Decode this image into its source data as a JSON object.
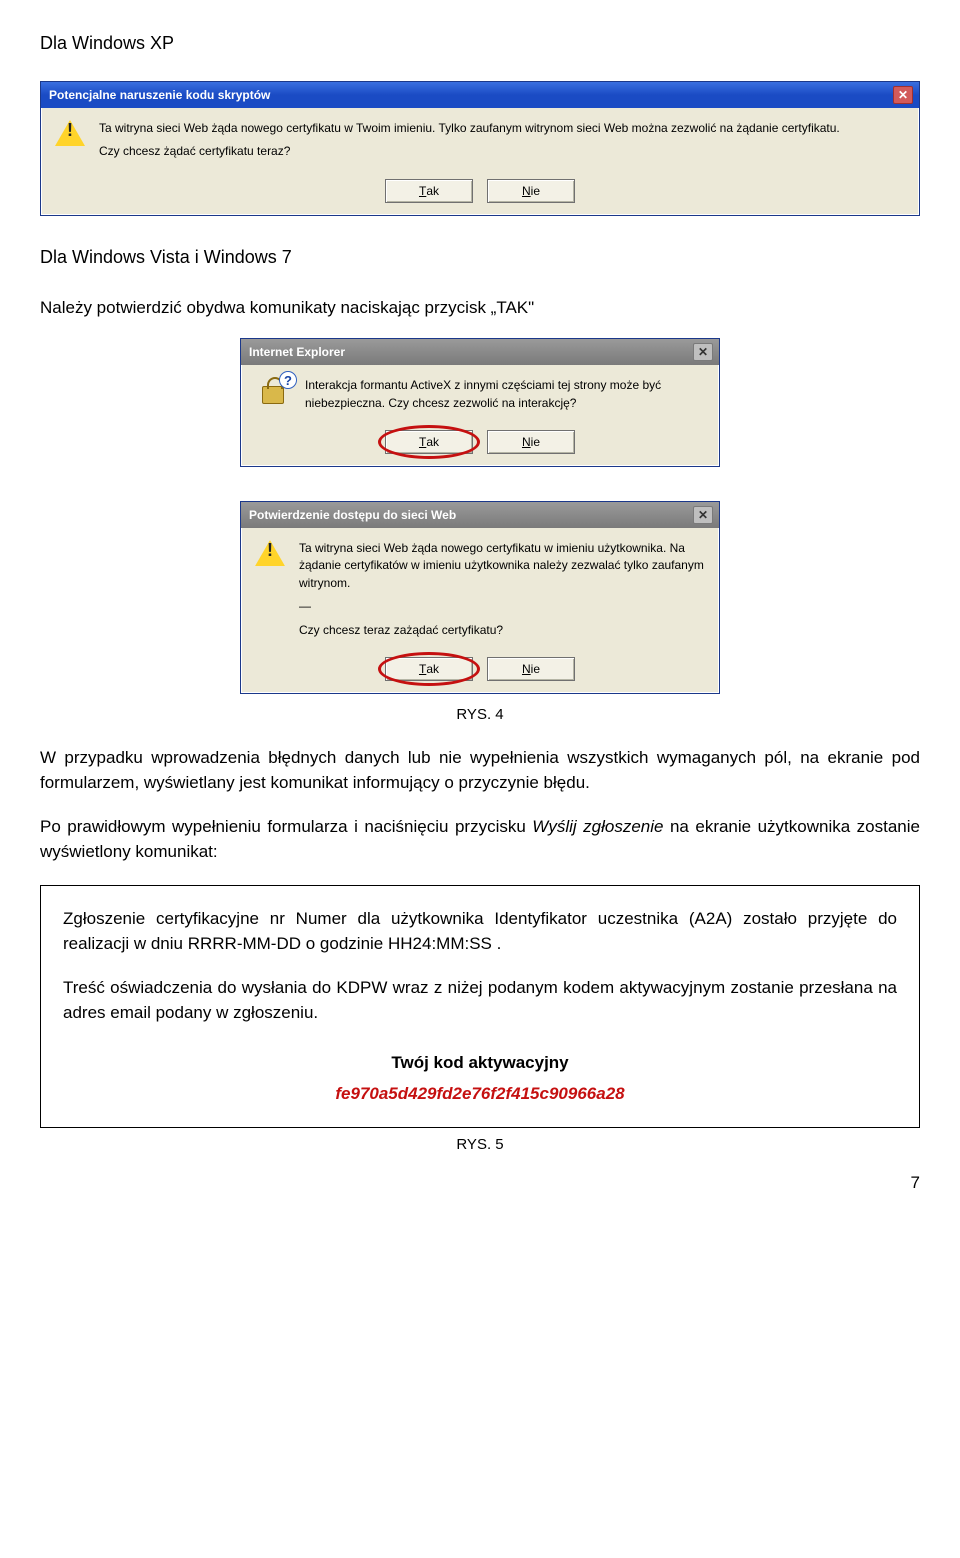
{
  "headings": {
    "xp": "Dla Windows XP",
    "vista": "Dla Windows Vista i Windows 7",
    "instr": "Należy potwierdzić obydwa komunikaty naciskając przycisk „TAK\""
  },
  "dialog1": {
    "title": "Potencjalne naruszenie kodu skryptów",
    "line1": "Ta witryna sieci Web żąda nowego certyfikatu w Twoim imieniu. Tylko zaufanym witrynom sieci Web można zezwolić na żądanie certyfikatu.",
    "line2": "Czy chcesz żądać certyfikatu teraz?",
    "yes_html": "<span class=\"ul\">T</span>ak",
    "no_html": "<span class=\"ul\">N</span>ie"
  },
  "dialog2": {
    "title": "Internet Explorer",
    "line1": "Interakcja formantu ActiveX z innymi częściami tej strony może być niebezpieczna. Czy chcesz zezwolić na interakcję?",
    "yes_html": "<span class=\"ul\">T</span>ak",
    "no_html": "<span class=\"ul\">N</span>ie"
  },
  "dialog3": {
    "title": "Potwierdzenie dostępu do sieci Web",
    "line1": "Ta witryna sieci Web żąda nowego certyfikatu w imieniu użytkownika. Na żądanie certyfikatów w imieniu użytkownika należy zezwalać tylko zaufanym witrynom.",
    "dash": "—",
    "line2": "Czy chcesz teraz zażądać certyfikatu?",
    "yes_html": "<span class=\"ul\">T</span>ak",
    "no_html": "<span class=\"ul\">N</span>ie"
  },
  "captions": {
    "rys4": "RYS. 4",
    "rys5": "RYS. 5"
  },
  "body": {
    "p1": "W przypadku wprowadzenia błędnych danych lub nie wypełnienia wszystkich wymaganych pól, na ekranie pod formularzem, wyświetlany jest komunikat informujący o przyczynie błędu.",
    "p2_prefix": "Po prawidłowym wypełnieniu formularza i naciśnięciu przycisku ",
    "p2_em": "Wyślij zgłoszenie",
    "p2_suffix": " na ekranie użytkownika zostanie wyświetlony komunikat:"
  },
  "result": {
    "p1": "Zgłoszenie certyfikacyjne nr Numer  dla użytkownika Identyfikator uczestnika (A2A) zostało przyjęte do realizacji  w dniu  RRRR-MM-DD o godzinie HH24:MM:SS .",
    "p2": "Treść oświadczenia do wysłania do KDPW wraz z niżej podanym kodem aktywacyjnym zostanie przesłana na adres email podany w zgłoszeniu.",
    "kod_title": "Twój kod aktywacyjny",
    "code": "fe970a5d429fd2e76f2f415c90966a28"
  },
  "page_number": "7"
}
